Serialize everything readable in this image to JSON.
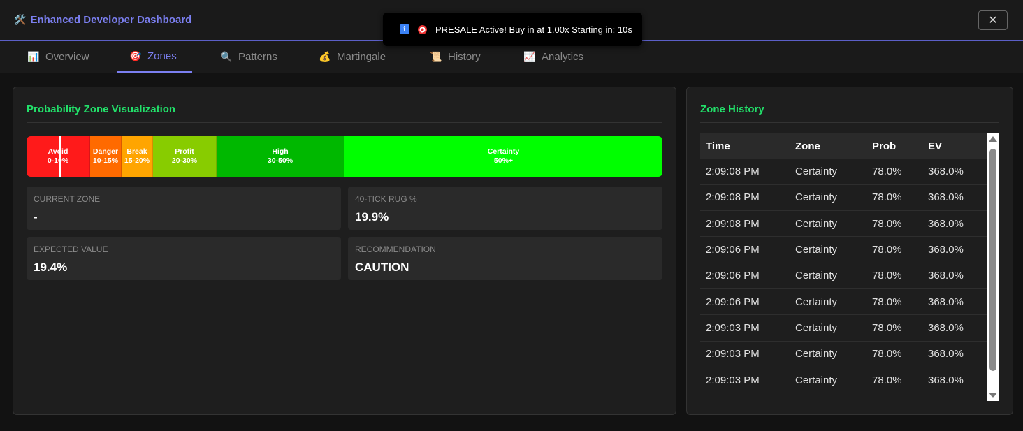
{
  "header": {
    "icon": "🛠️",
    "title": "Enhanced Developer Dashboard",
    "close_label": "✕"
  },
  "toast": {
    "text": "PRESALE Active! Buy in at 1.00x Starting in: 10s",
    "info_label": "i"
  },
  "tabs": [
    {
      "icon": "📊",
      "label": "Overview"
    },
    {
      "icon": "🎯",
      "label": "Zones"
    },
    {
      "icon": "🔍",
      "label": "Patterns"
    },
    {
      "icon": "💰",
      "label": "Martingale"
    },
    {
      "icon": "📜",
      "label": "History"
    },
    {
      "icon": "📈",
      "label": "Analytics"
    }
  ],
  "active_tab": "Zones",
  "zones_panel": {
    "title": "Probability Zone Visualization",
    "zones": [
      {
        "name": "Avoid",
        "range": "0-10%",
        "color": "#ff1a1a"
      },
      {
        "name": "Danger",
        "range": "10-15%",
        "color": "#ff6a00"
      },
      {
        "name": "Break",
        "range": "15-20%",
        "color": "#ffa500"
      },
      {
        "name": "Profit",
        "range": "20-30%",
        "color": "#88cc00"
      },
      {
        "name": "High",
        "range": "30-50%",
        "color": "#00b800"
      },
      {
        "name": "Certainty",
        "range": "50%+",
        "color": "#00ff00"
      }
    ],
    "stats": {
      "current_zone": {
        "label": "CURRENT ZONE",
        "value": "-"
      },
      "rug": {
        "label": "40-TICK RUG %",
        "value": "19.9%"
      },
      "ev": {
        "label": "EXPECTED VALUE",
        "value": "19.4%"
      },
      "recommendation": {
        "label": "RECOMMENDATION",
        "value": "CAUTION"
      }
    }
  },
  "history_panel": {
    "title": "Zone History",
    "columns": [
      "Time",
      "Zone",
      "Prob",
      "EV"
    ],
    "rows": [
      [
        "2:09:08 PM",
        "Certainty",
        "78.0%",
        "368.0%"
      ],
      [
        "2:09:08 PM",
        "Certainty",
        "78.0%",
        "368.0%"
      ],
      [
        "2:09:08 PM",
        "Certainty",
        "78.0%",
        "368.0%"
      ],
      [
        "2:09:06 PM",
        "Certainty",
        "78.0%",
        "368.0%"
      ],
      [
        "2:09:06 PM",
        "Certainty",
        "78.0%",
        "368.0%"
      ],
      [
        "2:09:06 PM",
        "Certainty",
        "78.0%",
        "368.0%"
      ],
      [
        "2:09:03 PM",
        "Certainty",
        "78.0%",
        "368.0%"
      ],
      [
        "2:09:03 PM",
        "Certainty",
        "78.0%",
        "368.0%"
      ],
      [
        "2:09:03 PM",
        "Certainty",
        "78.0%",
        "368.0%"
      ]
    ]
  }
}
